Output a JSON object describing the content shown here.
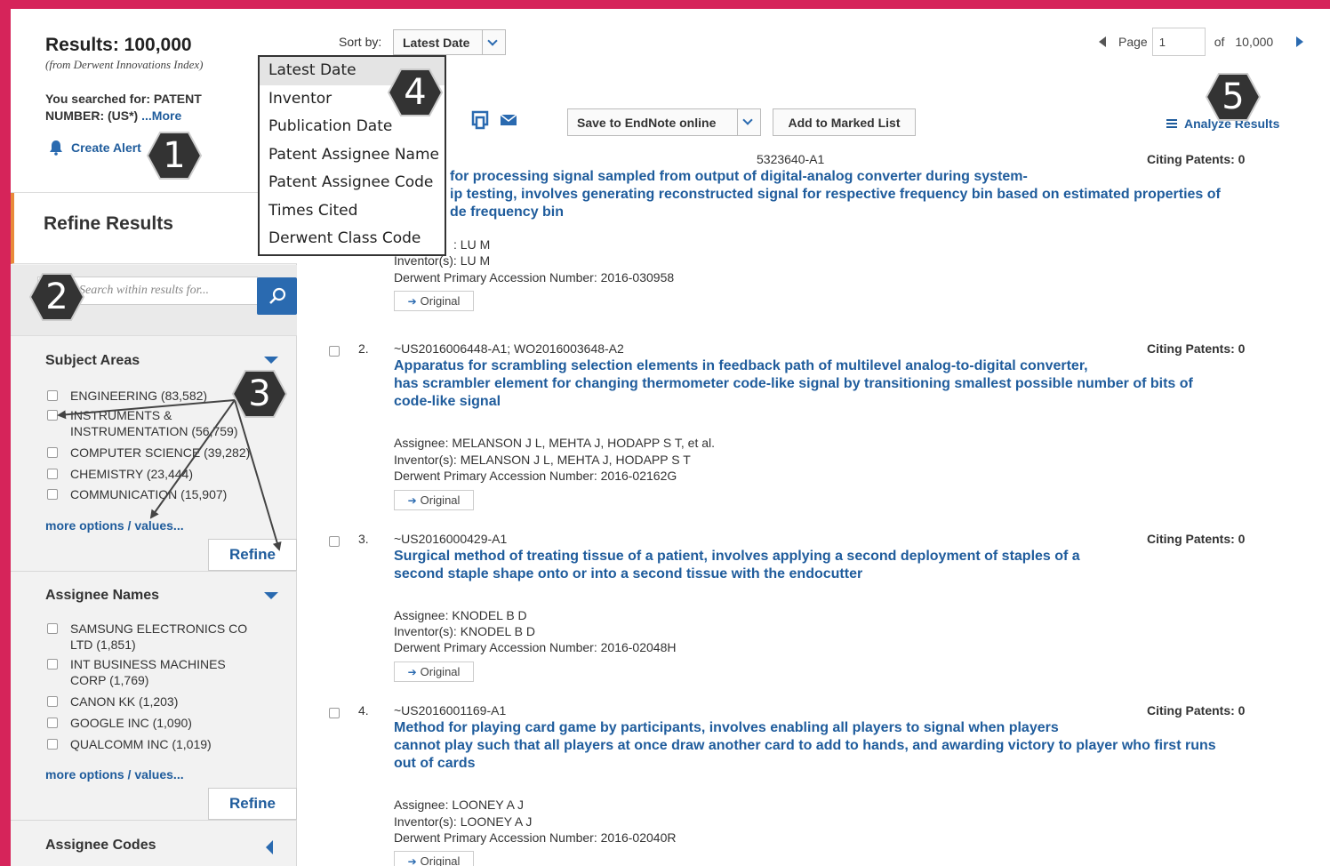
{
  "sidebar": {
    "results_title": "Results: 100,000",
    "results_source": "(from Derwent Innovations Index)",
    "searched_prefix": "You searched for: PATENT NUMBER: (US*) ",
    "searched_more": "...More",
    "create_alert": "Create Alert",
    "refine_results": "Refine Results",
    "search_placeholder": "Search within results for...",
    "subject_areas": {
      "title": "Subject Areas",
      "items": [
        "ENGINEERING (83,582)",
        "INSTRUMENTS & INSTRUMENTATION (56,759)",
        "COMPUTER SCIENCE (39,282)",
        "CHEMISTRY (23,444)",
        "COMMUNICATION (15,907)"
      ],
      "more": "more options / values...",
      "refine": "Refine"
    },
    "assignee_names": {
      "title": "Assignee Names",
      "items": [
        "SAMSUNG ELECTRONICS CO LTD (1,851)",
        "INT BUSINESS MACHINES CORP (1,769)",
        "CANON KK (1,203)",
        "GOOGLE INC (1,090)",
        "QUALCOMM INC (1,019)"
      ],
      "more": "more options / values...",
      "refine": "Refine"
    },
    "assignee_codes": {
      "title": "Assignee Codes"
    }
  },
  "toolbar": {
    "sort_label": "Sort by:",
    "sort_value": "Latest Date",
    "page_label": "Page",
    "page_value": "1",
    "of_label": "of",
    "total_pages": "10,000",
    "save_endnote": "Save to EndNote online",
    "add_marked": "Add to Marked List",
    "analyze": "Analyze Results"
  },
  "sort_options": [
    "Latest Date",
    "Inventor",
    "Publication Date",
    "Patent Assignee Name",
    "Patent Assignee Code",
    "Times Cited",
    "Derwent Class Code"
  ],
  "records": [
    {
      "num": "",
      "id": "-US2016003640-A1",
      "id_visible": "5323640-A1",
      "citing": "Citing Patents: 0",
      "title_lines": [
        "for processing signal sampled from output of digital-analog converter during system-",
        "ip testing, involves generating reconstructed signal for respective frequency bin based on estimated properties of",
        "de frequency bin"
      ],
      "assignee": ": LU M",
      "inventor": "Inventor(s): LU M",
      "accession": "Derwent Primary Accession Number: 2016-030958",
      "original": "Original"
    },
    {
      "num": "2.",
      "id": "~US2016006448-A1; WO2016003648-A2",
      "citing": "Citing Patents: 0",
      "title_lines": [
        "Apparatus for scrambling selection elements in feedback path of multilevel analog-to-digital converter,",
        "has scrambler element for changing thermometer code-like signal by transitioning smallest possible number of bits of",
        "code-like signal"
      ],
      "assignee": "Assignee: MELANSON J L, MEHTA J, HODAPP S T, et al.",
      "inventor": "Inventor(s): MELANSON J L, MEHTA J, HODAPP S T",
      "accession": "Derwent Primary Accession Number: 2016-02162G",
      "original": "Original"
    },
    {
      "num": "3.",
      "id": "~US2016000429-A1",
      "citing": "Citing Patents: 0",
      "title_lines": [
        "Surgical method of treating tissue of a patient, involves applying a second deployment of staples of a",
        "second staple shape onto or into a second tissue with the endocutter"
      ],
      "assignee": "Assignee: KNODEL B D",
      "inventor": "Inventor(s): KNODEL B D",
      "accession": "Derwent Primary Accession Number: 2016-02048H",
      "original": "Original"
    },
    {
      "num": "4.",
      "id": "~US2016001169-A1",
      "citing": "Citing Patents: 0",
      "title_lines": [
        "Method for playing card game by participants, involves enabling all players to signal when players",
        "cannot play such that all players at once draw another card to add to hands, and awarding victory to player who first runs",
        "out of cards"
      ],
      "assignee": "Assignee: LOONEY A J",
      "inventor": "Inventor(s): LOONEY A J",
      "accession": "Derwent Primary Accession Number: 2016-02040R",
      "original": "Original"
    }
  ],
  "markers": [
    "1",
    "2",
    "3",
    "4",
    "5"
  ],
  "colors": {
    "border": "#d6245a",
    "link": "#1f5c9c",
    "accent": "#e88a3a",
    "marker": "#333333"
  }
}
